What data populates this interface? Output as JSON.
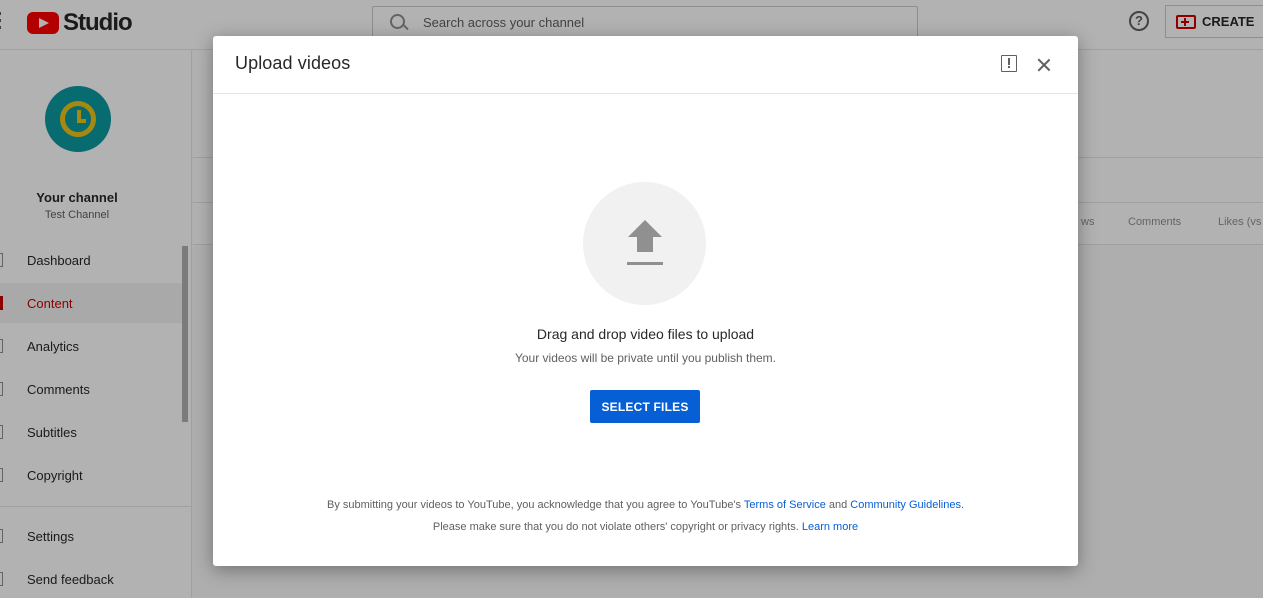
{
  "header": {
    "logo_text": "Studio",
    "search_placeholder": "Search across your channel",
    "help_icon_text": "?",
    "create_label": "CREATE"
  },
  "sidebar": {
    "channel_title": "Your channel",
    "channel_name": "Test Channel",
    "items": [
      {
        "label": "Dashboard",
        "active": false
      },
      {
        "label": "Content",
        "active": true
      },
      {
        "label": "Analytics",
        "active": false
      },
      {
        "label": "Comments",
        "active": false
      },
      {
        "label": "Subtitles",
        "active": false
      },
      {
        "label": "Copyright",
        "active": false
      }
    ],
    "bottom_items": [
      {
        "label": "Settings"
      },
      {
        "label": "Send feedback"
      }
    ]
  },
  "main": {
    "columns": [
      "ws",
      "Comments",
      "Likes (vs"
    ]
  },
  "dialog": {
    "title": "Upload videos",
    "drag_text": "Drag and drop video files to upload",
    "private_text": "Your videos will be private until you publish them.",
    "select_button": "SELECT FILES",
    "legal": {
      "line1_prefix": "By submitting your videos to YouTube, you acknowledge that you agree to YouTube's ",
      "terms_link": "Terms of Service",
      "line1_and": " and ",
      "guidelines_link": "Community Guidelines",
      "line1_suffix": ".",
      "line2_prefix": "Please make sure that you do not violate others' copyright or privacy rights. ",
      "learn_more_link": "Learn more"
    }
  },
  "colors": {
    "accent_blue": "#065fd4",
    "active_red": "#cc0000",
    "brand_red": "#ff0000",
    "avatar_teal": "#0c9aa0",
    "avatar_yellow": "#f0c419"
  }
}
